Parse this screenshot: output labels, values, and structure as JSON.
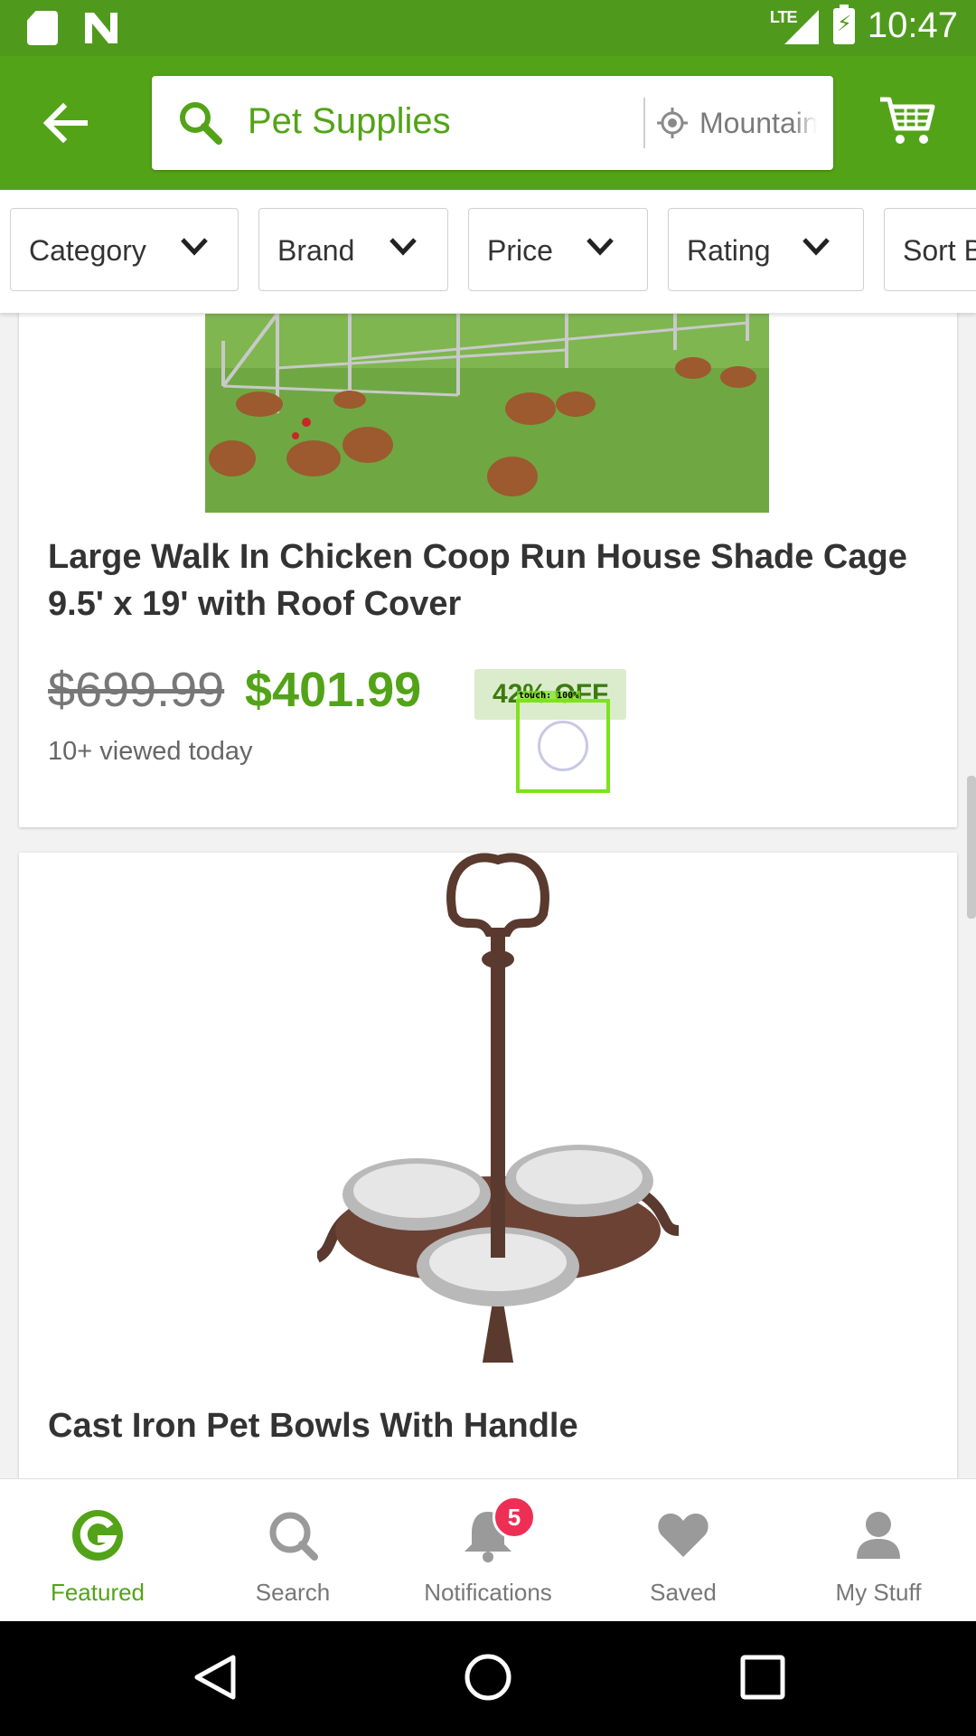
{
  "status_bar": {
    "time": "10:47",
    "network": "LTE",
    "icons": [
      "sd-card-icon",
      "n-logo-icon",
      "signal-icon",
      "battery-charging-icon"
    ]
  },
  "header": {
    "back_icon": "arrow-left-icon",
    "search_query": "Pet Supplies",
    "location": "Mountain View",
    "cart_icon": "cart-icon"
  },
  "filters": [
    {
      "label": "Category"
    },
    {
      "label": "Brand"
    },
    {
      "label": "Price"
    },
    {
      "label": "Rating"
    },
    {
      "label": "Sort By"
    }
  ],
  "products": [
    {
      "title": "Large Walk In Chicken Coop Run House Shade Cage 9.5' x 19' with Roof Cover",
      "original_price": "$699.99",
      "price": "$401.99",
      "discount": "42% OFF",
      "viewed": "10+ viewed today"
    },
    {
      "title": "Cast Iron Pet Bowls With Handle"
    }
  ],
  "touch_indicator": {
    "label": "touch: 100%"
  },
  "bottom_nav": [
    {
      "label": "Featured",
      "icon": "groupon-g-icon",
      "active": true
    },
    {
      "label": "Search",
      "icon": "search-icon"
    },
    {
      "label": "Notifications",
      "icon": "bell-icon",
      "badge": "5"
    },
    {
      "label": "Saved",
      "icon": "heart-icon"
    },
    {
      "label": "My Stuff",
      "icon": "person-icon"
    }
  ],
  "colors": {
    "brand_green": "#53a318",
    "status_green": "#4f9a1c",
    "badge_red": "#ee2f55",
    "discount_bg": "#dbeccc"
  }
}
